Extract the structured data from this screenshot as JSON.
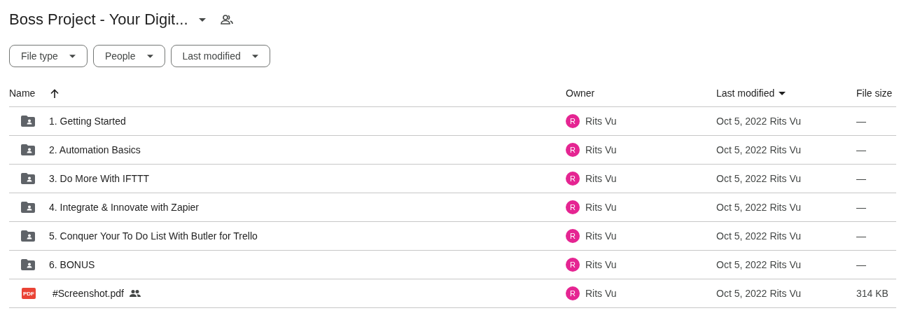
{
  "title": "Boss Project - Your Digit...",
  "filters": [
    {
      "label": "File type"
    },
    {
      "label": "People"
    },
    {
      "label": "Last modified"
    }
  ],
  "columns": [
    {
      "label": "Name",
      "kind": "sorted"
    },
    {
      "label": "Owner",
      "kind": "plain"
    },
    {
      "label": "Last modified",
      "kind": "menu"
    },
    {
      "label": "File size",
      "kind": "plain"
    }
  ],
  "rows": [
    {
      "kind": "folder",
      "name": "1. Getting Started",
      "shared": false,
      "owner_initial": "R",
      "owner": "Rits Vu",
      "modified": "Oct 5, 2022",
      "modified_by": "Rits Vu",
      "size": "—"
    },
    {
      "kind": "folder",
      "name": "2. Automation Basics",
      "shared": false,
      "owner_initial": "R",
      "owner": "Rits Vu",
      "modified": "Oct 5, 2022",
      "modified_by": "Rits Vu",
      "size": "—"
    },
    {
      "kind": "folder",
      "name": "3. Do More With IFTTT",
      "shared": false,
      "owner_initial": "R",
      "owner": "Rits Vu",
      "modified": "Oct 5, 2022",
      "modified_by": "Rits Vu",
      "size": "—"
    },
    {
      "kind": "folder",
      "name": "4. Integrate & Innovate with Zapier",
      "shared": false,
      "owner_initial": "R",
      "owner": "Rits Vu",
      "modified": "Oct 5, 2022",
      "modified_by": "Rits Vu",
      "size": "—"
    },
    {
      "kind": "folder",
      "name": "5. Conquer Your To Do List With Butler for Trello",
      "shared": false,
      "owner_initial": "R",
      "owner": "Rits Vu",
      "modified": "Oct 5, 2022",
      "modified_by": "Rits Vu",
      "size": "—"
    },
    {
      "kind": "folder",
      "name": "6. BONUS",
      "shared": false,
      "owner_initial": "R",
      "owner": "Rits Vu",
      "modified": "Oct 5, 2022",
      "modified_by": "Rits Vu",
      "size": "—"
    },
    {
      "kind": "pdf",
      "icon_text": "PDF",
      "name": "#Screenshot.pdf",
      "shared": true,
      "owner_initial": "R",
      "owner": "Rits Vu",
      "modified": "Oct 5, 2022",
      "modified_by": "Rits Vu",
      "size": "314 KB"
    }
  ]
}
